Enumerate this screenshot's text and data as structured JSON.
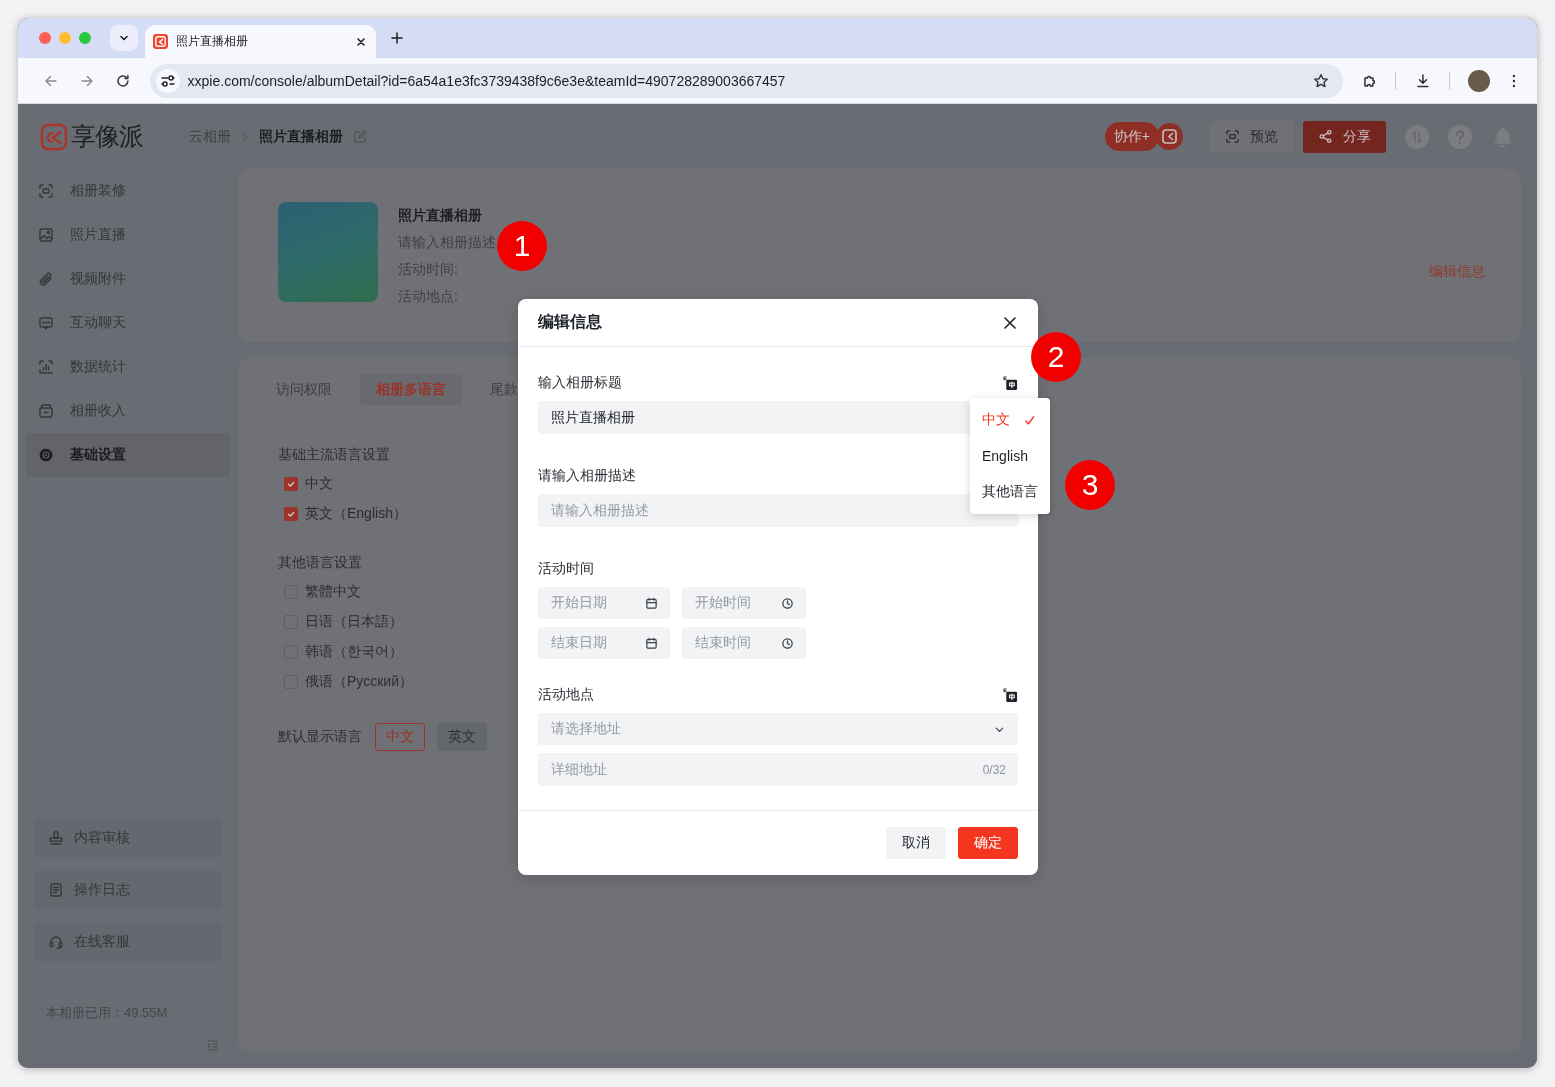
{
  "browser": {
    "tab_title": "照片直播相册",
    "url": "xxpie.com/console/albumDetail?id=6a54a1e3fc3739438f9c6e3e&teamId=490728289003667457"
  },
  "header": {
    "logo_text": "享像派",
    "breadcrumb": [
      "云相册",
      "照片直播相册"
    ],
    "collab_label": "协作+",
    "buttons": [
      {
        "label": "预览",
        "kind": "secondary"
      },
      {
        "label": "分享",
        "kind": "primary"
      }
    ]
  },
  "sidebar": {
    "items": [
      {
        "label": "相册装修",
        "selected": false
      },
      {
        "label": "照片直播",
        "selected": false
      },
      {
        "label": "视频附件",
        "selected": false
      },
      {
        "label": "互动聊天",
        "selected": false
      },
      {
        "label": "数据统计",
        "selected": false
      },
      {
        "label": "相册收入",
        "selected": false
      },
      {
        "label": "基础设置",
        "selected": true
      }
    ],
    "bottom_items": [
      {
        "label": "内容审核"
      },
      {
        "label": "操作日志"
      },
      {
        "label": "在线客服"
      }
    ],
    "storage": "本相册已用：49.55M"
  },
  "album": {
    "title": "照片直播相册",
    "description": "请输入相册描述",
    "time_label": "活动时间:",
    "place_label": "活动地点:",
    "edit_link": "编辑信息"
  },
  "settings": {
    "tabs": [
      {
        "label": "访问权限",
        "selected": false
      },
      {
        "label": "相册多语言",
        "selected": true
      },
      {
        "label": "尾款",
        "selected": false
      }
    ],
    "groups": [
      {
        "title": "基础主流语言设置",
        "options": [
          {
            "label": "中文",
            "checked": true
          },
          {
            "label": "英文（English）",
            "checked": true
          }
        ]
      },
      {
        "title": "其他语言设置",
        "options": [
          {
            "label": "繁體中文",
            "checked": false
          },
          {
            "label": "日语（日本語）",
            "checked": false
          },
          {
            "label": "韩语（한국어）",
            "checked": false
          },
          {
            "label": "俄语（Русский）",
            "checked": false
          }
        ]
      }
    ],
    "default_language": {
      "label": "默认显示语言",
      "options": [
        {
          "label": "中文",
          "selected": true
        },
        {
          "label": "英文",
          "selected": false
        }
      ]
    }
  },
  "dialog": {
    "title": "编辑信息",
    "sections": [
      {
        "label": "输入相册标题",
        "translatable": true,
        "fields": [
          {
            "kind": "text",
            "value": "照片直播相册"
          }
        ]
      },
      {
        "label": "请输入相册描述",
        "fields": [
          {
            "kind": "text",
            "placeholder": "请输入相册描述"
          }
        ]
      },
      {
        "label": "活动时间",
        "fields": [
          {
            "kind": "date",
            "placeholder": "开始日期"
          },
          {
            "kind": "time",
            "placeholder": "开始时间"
          },
          {
            "kind": "date",
            "placeholder": "结束日期"
          },
          {
            "kind": "time",
            "placeholder": "结束时间"
          }
        ]
      },
      {
        "label": "活动地点",
        "translatable": true,
        "fields": [
          {
            "kind": "select",
            "placeholder": "请选择地址"
          },
          {
            "kind": "text",
            "placeholder": "详细地址",
            "counter": "0/32"
          }
        ]
      }
    ],
    "buttons": [
      {
        "label": "取消",
        "kind": "secondary"
      },
      {
        "label": "确定",
        "kind": "primary"
      }
    ]
  },
  "language_menu": {
    "items": [
      {
        "label": "中文",
        "selected": true
      },
      {
        "label": "English",
        "selected": false
      },
      {
        "label": "其他语言",
        "selected": false
      }
    ]
  },
  "annotations": [
    {
      "label": "1"
    },
    {
      "label": "2"
    },
    {
      "label": "3"
    }
  ]
}
